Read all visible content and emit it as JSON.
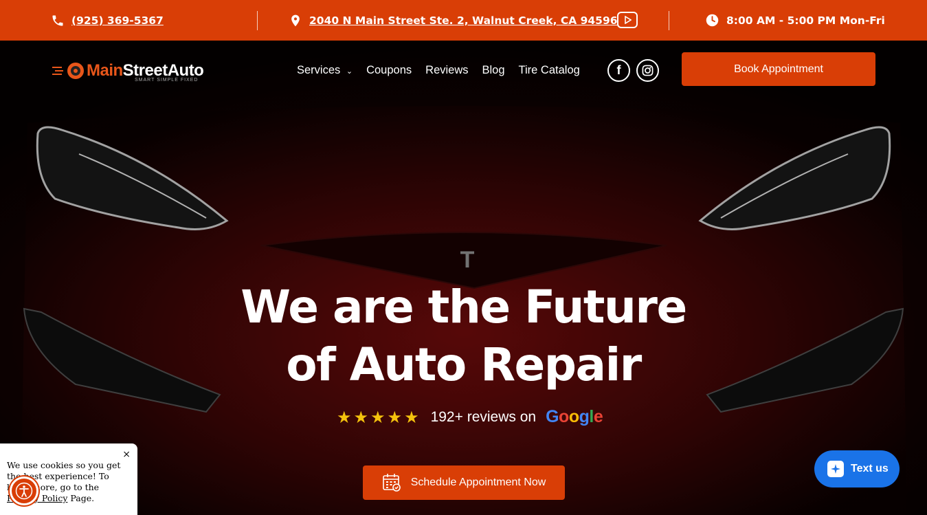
{
  "topbar": {
    "phone": "(925) 369-5367",
    "address": "2040 N Main Street Ste. 2, Walnut Creek, CA 94596",
    "hours": "8:00 AM - 5:00 PM Mon-Fri"
  },
  "logo": {
    "main": "Main",
    "street_auto": "StreetAuto",
    "tagline": "SMART SIMPLE FIXED"
  },
  "nav": {
    "services": "Services",
    "coupons": "Coupons",
    "reviews": "Reviews",
    "blog": "Blog",
    "tire_catalog": "Tire Catalog"
  },
  "social": {
    "facebook_glyph": "f"
  },
  "book_button": "Book Appointment",
  "hero": {
    "headline_line1": "We are the Future",
    "headline_line2": "of Auto Repair",
    "stars": "★★★★★",
    "reviews_text": "192+ reviews on",
    "google_letters": [
      "G",
      "o",
      "o",
      "g",
      "l",
      "e"
    ]
  },
  "schedule_button": "Schedule Appointment Now",
  "cookie": {
    "text_before": "We use cookies so you get the best experience! To learn more, go to the ",
    "link": "Privacy Policy",
    "text_after": " Page.",
    "close": "×"
  },
  "text_us": "Text us",
  "colors": {
    "accent": "#d93e06",
    "chat_blue": "#1a73e8",
    "star": "#f4c20d"
  }
}
